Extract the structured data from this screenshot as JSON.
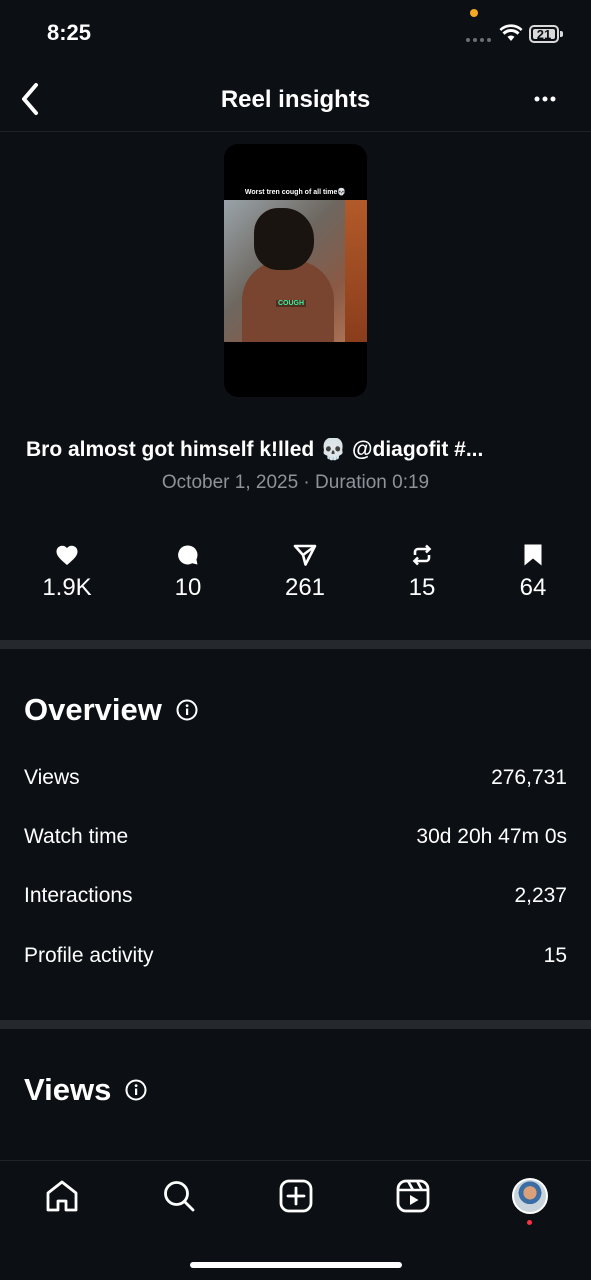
{
  "status_bar": {
    "time": "8:25",
    "battery": "21"
  },
  "header": {
    "title": "Reel insights",
    "back_icon": "chevron-left-icon",
    "more_icon": "more-horizontal-icon"
  },
  "reel": {
    "thumbnail_caption": "Worst tren cough of all time💀",
    "thumbnail_subtitle": "COUGH",
    "caption": "Bro almost got himself k!lled 💀 @diagofit #...",
    "meta": "October 1, 2025 · Duration 0:19"
  },
  "stats": [
    {
      "icon": "heart-icon",
      "value": "1.9K"
    },
    {
      "icon": "comment-icon",
      "value": "10"
    },
    {
      "icon": "send-icon",
      "value": "261"
    },
    {
      "icon": "repost-icon",
      "value": "15"
    },
    {
      "icon": "bookmark-icon",
      "value": "64"
    }
  ],
  "overview": {
    "title": "Overview",
    "rows": [
      {
        "label": "Views",
        "value": "276,731"
      },
      {
        "label": "Watch time",
        "value": "30d 20h 47m 0s"
      },
      {
        "label": "Interactions",
        "value": "2,237"
      },
      {
        "label": "Profile activity",
        "value": "15"
      }
    ]
  },
  "views_section": {
    "title": "Views"
  },
  "bottom_nav": [
    "home-icon",
    "search-icon",
    "create-icon",
    "reels-icon",
    "profile-avatar"
  ]
}
